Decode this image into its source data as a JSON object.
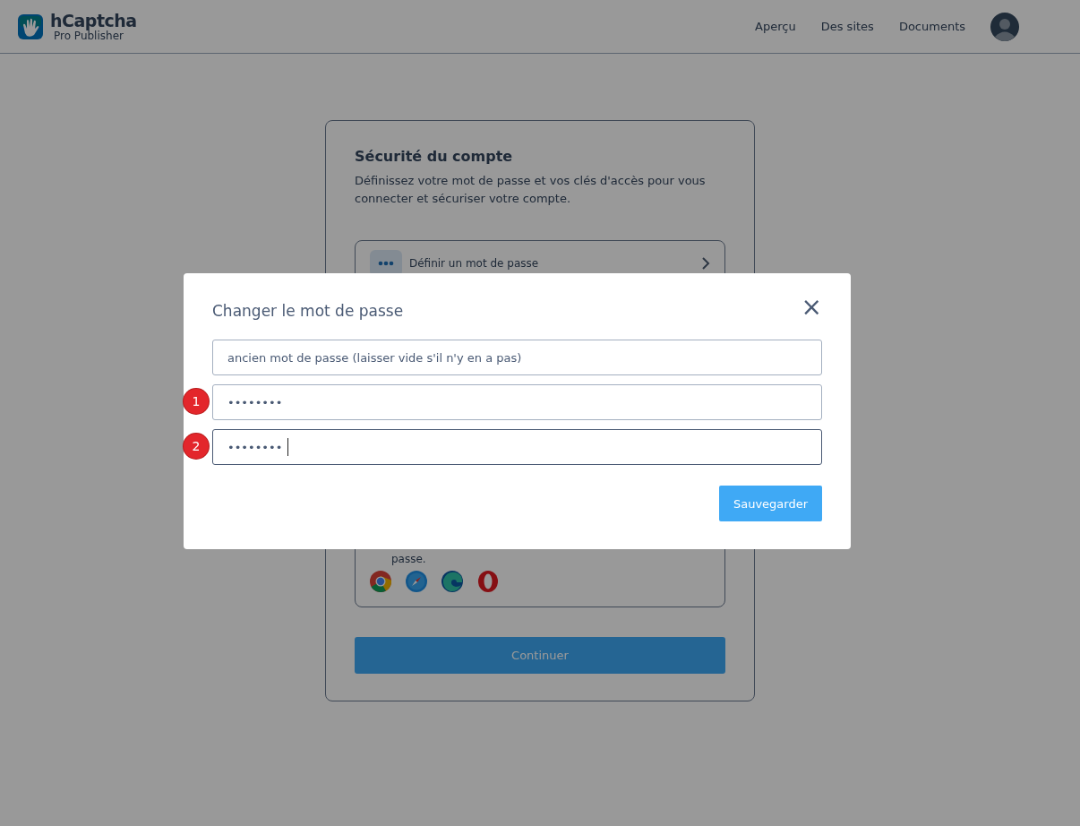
{
  "header": {
    "logo": {
      "name": "hCaptcha",
      "subtitle": "Pro Publisher"
    },
    "nav": [
      {
        "label": "Aperçu"
      },
      {
        "label": "Des sites"
      },
      {
        "label": "Documents"
      }
    ]
  },
  "card": {
    "title": "Sécurité du compte",
    "description": "Définissez votre mot de passe et vos clés d'accès pour vous connecter et sécuriser votre compte.",
    "option": "Définir un mot de passe",
    "note_tail": "passe.",
    "browsers": [
      {
        "kind": "chrome"
      },
      {
        "kind": "safari"
      },
      {
        "kind": "edge"
      },
      {
        "kind": "opera"
      }
    ],
    "continue_button": "Continuer"
  },
  "modal": {
    "title": "Changer le mot de passe",
    "close": "×",
    "fields": [
      {
        "placeholder": "ancien mot de passe (laisser vide s'il n'y en a pas)",
        "focused": false
      },
      {
        "value": "••••••••",
        "marker": "1",
        "focused": false
      },
      {
        "value": "••••••••",
        "marker": "2",
        "focused": true
      }
    ],
    "save_button": "Sauvegarder"
  }
}
